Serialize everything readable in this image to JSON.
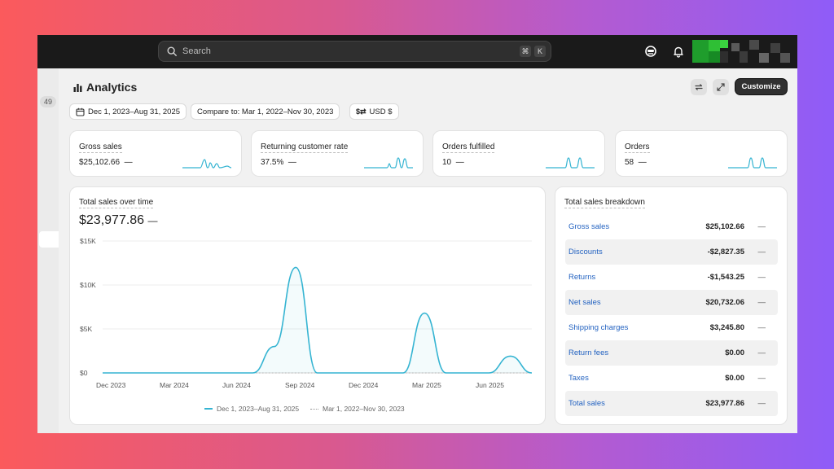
{
  "search": {
    "placeholder": "Search",
    "shortcut_keys": [
      "⌘",
      "K"
    ]
  },
  "rail": {
    "badge": "49"
  },
  "header": {
    "title": "Analytics",
    "customize_label": "Customize"
  },
  "filters": {
    "date_range": "Dec 1, 2023–Aug 31, 2025",
    "compare_to": "Compare to: Mar 1, 2022–Nov 30, 2023",
    "currency": "USD $"
  },
  "metrics": [
    {
      "label": "Gross sales",
      "value": "$25,102.66",
      "change": "—"
    },
    {
      "label": "Returning customer rate",
      "value": "37.5%",
      "change": "—"
    },
    {
      "label": "Orders fulfilled",
      "value": "10",
      "change": "—"
    },
    {
      "label": "Orders",
      "value": "58",
      "change": "—"
    }
  ],
  "sales_chart": {
    "title": "Total sales over time",
    "total": "$23,977.86",
    "change": "—"
  },
  "chart_data": {
    "type": "line",
    "title": "Total sales over time",
    "xlabel": "",
    "ylabel": "",
    "y_tick_labels": [
      "$15K",
      "$10K",
      "$5K",
      "$0"
    ],
    "x_tick_labels": [
      "Dec 2023",
      "Mar 2024",
      "Jun 2024",
      "Sep 2024",
      "Dec 2024",
      "Mar 2025",
      "Jun 2025"
    ],
    "ylim": [
      0,
      15000
    ],
    "grid": true,
    "legend_position": "bottom",
    "series": [
      {
        "name": "Dec 1, 2023–Aug 31, 2025",
        "color": "#35b4d2",
        "style": "solid",
        "x": [
          "2023-12",
          "2024-01",
          "2024-02",
          "2024-03",
          "2024-04",
          "2024-05",
          "2024-06",
          "2024-07",
          "2024-08",
          "2024-09",
          "2024-10",
          "2024-11",
          "2024-12",
          "2025-01",
          "2025-02",
          "2025-03",
          "2025-04",
          "2025-05",
          "2025-06",
          "2025-07",
          "2025-08"
        ],
        "values": [
          0,
          0,
          0,
          0,
          0,
          0,
          0,
          0,
          3000,
          12000,
          0,
          0,
          0,
          0,
          0,
          6800,
          0,
          0,
          0,
          1900,
          0
        ]
      },
      {
        "name": "Mar 1, 2022–Nov 30, 2023",
        "color": "#b0b0b0",
        "style": "dotted",
        "values": [
          0,
          0,
          0,
          0,
          0,
          0,
          0,
          0,
          0,
          0,
          0,
          0,
          0,
          0,
          0,
          0,
          0,
          0,
          0,
          0,
          0
        ]
      }
    ]
  },
  "breakdown": {
    "title": "Total sales breakdown",
    "rows": [
      {
        "name": "Gross sales",
        "value": "$25,102.66",
        "change": "—"
      },
      {
        "name": "Discounts",
        "value": "-$2,827.35",
        "change": "—"
      },
      {
        "name": "Returns",
        "value": "-$1,543.25",
        "change": "—"
      },
      {
        "name": "Net sales",
        "value": "$20,732.06",
        "change": "—"
      },
      {
        "name": "Shipping charges",
        "value": "$3,245.80",
        "change": "—"
      },
      {
        "name": "Return fees",
        "value": "$0.00",
        "change": "—"
      },
      {
        "name": "Taxes",
        "value": "$0.00",
        "change": "—"
      },
      {
        "name": "Total sales",
        "value": "$23,977.86",
        "change": "—"
      }
    ]
  },
  "colors": {
    "accent": "#35b4d2",
    "link": "#2463c1",
    "topbar": "#1a1a1a"
  }
}
